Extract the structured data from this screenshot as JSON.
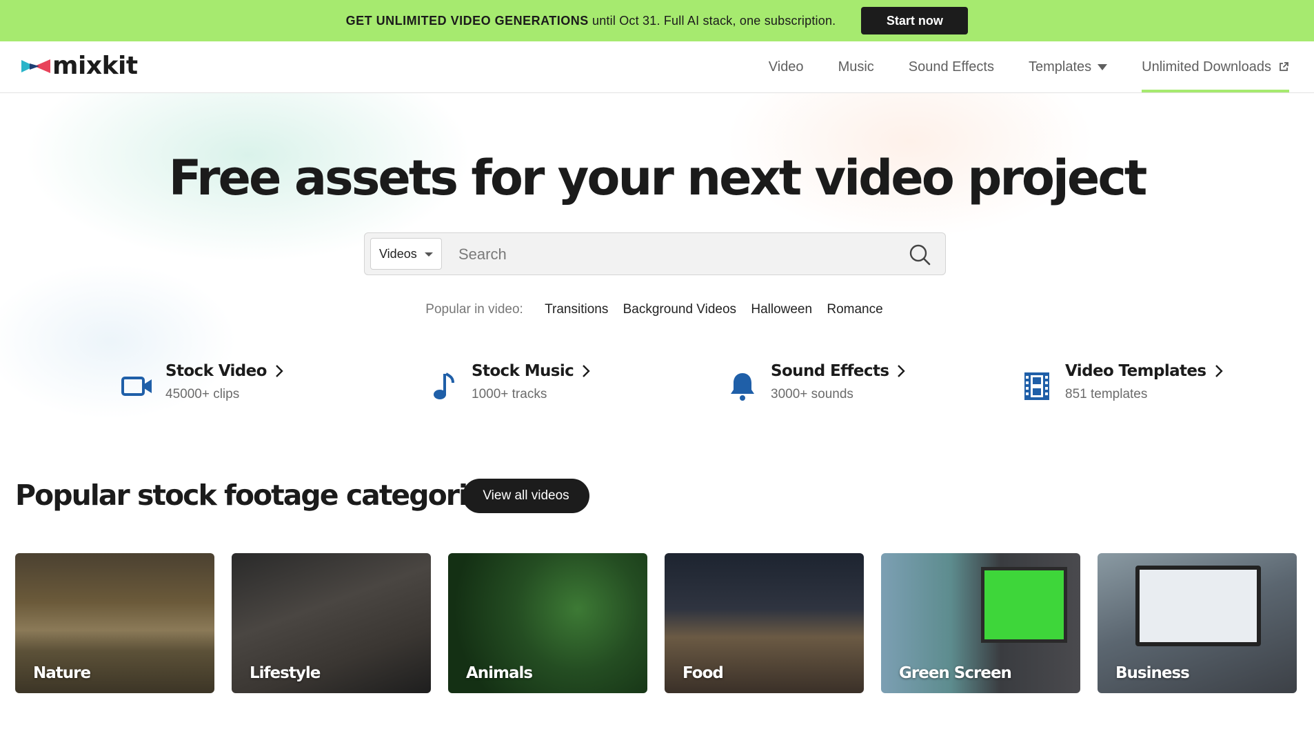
{
  "promo": {
    "highlight": "GET UNLIMITED VIDEO GENERATIONS",
    "rest": " until Oct 31. Full AI stack, one subscription.",
    "button": "Start now"
  },
  "header": {
    "logo_text": "mixkit",
    "nav": [
      {
        "label": "Video"
      },
      {
        "label": "Music"
      },
      {
        "label": "Sound Effects"
      },
      {
        "label": "Templates"
      },
      {
        "label": "Unlimited Downloads"
      }
    ]
  },
  "hero": {
    "headline": "Free assets for your next video project",
    "search": {
      "category": "Videos",
      "placeholder": "Search"
    },
    "popular_label": "Popular in video:",
    "popular_tags": [
      "Transitions",
      "Background Videos",
      "Halloween",
      "Romance"
    ]
  },
  "categories": [
    {
      "title": "Stock Video",
      "subtitle": "45000+ clips",
      "icon": "video-camera-icon"
    },
    {
      "title": "Stock Music",
      "subtitle": "1000+ tracks",
      "icon": "music-note-icon"
    },
    {
      "title": "Sound Effects",
      "subtitle": "3000+ sounds",
      "icon": "bell-icon"
    },
    {
      "title": "Video Templates",
      "subtitle": "851 templates",
      "icon": "film-strip-icon"
    }
  ],
  "popular_section": {
    "title": "Popular stock footage categories",
    "view_all": "View all videos",
    "cards": [
      "Nature",
      "Lifestyle",
      "Animals",
      "Food",
      "Green Screen",
      "Business"
    ]
  },
  "colors": {
    "accent": "#a6ea6f",
    "icon_blue": "#1f5fa8",
    "dark": "#1c1c1c"
  }
}
